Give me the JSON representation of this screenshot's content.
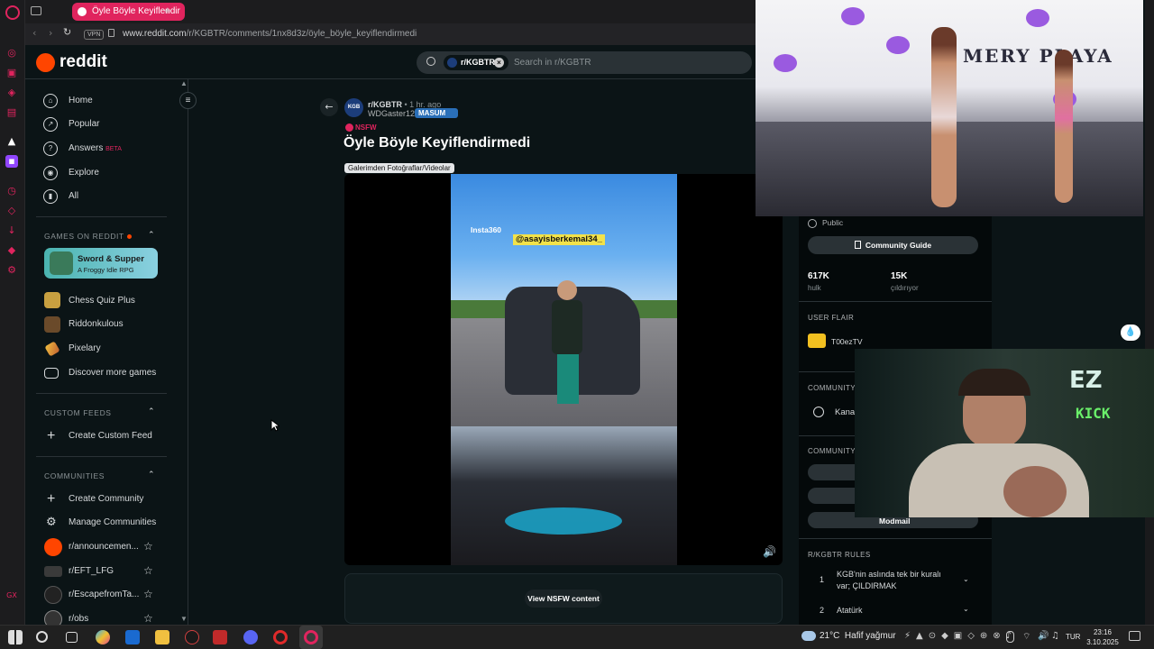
{
  "browser": {
    "tab_title": "Öyle Böyle Keyiflendir",
    "vpn_label": "VPN",
    "url_host": "www.reddit.com",
    "url_path": "/r/KGBTR/comments/1nx8d3z/öyle_böyle_keyiflendirmedi"
  },
  "reddit": {
    "logo_text": "reddit",
    "search_chip": "r/KGBTR",
    "search_placeholder": "Search in r/KGBTR"
  },
  "sidebar": {
    "nav": [
      {
        "label": "Home",
        "icon": "home-icon"
      },
      {
        "label": "Popular",
        "icon": "popular-icon"
      },
      {
        "label": "Answers",
        "badge": "BETA",
        "icon": "answers-icon"
      },
      {
        "label": "Explore",
        "icon": "explore-icon"
      },
      {
        "label": "All",
        "icon": "all-icon"
      }
    ],
    "games_title": "GAMES ON REDDIT",
    "featured_game": {
      "title": "Sword & Supper",
      "subtitle": "A Froggy Idle RPG"
    },
    "games": [
      "Chess Quiz Plus",
      "Riddonkulous",
      "Pixelary",
      "Discover more games"
    ],
    "custom_feeds_title": "CUSTOM FEEDS",
    "create_custom_feed": "Create Custom Feed",
    "communities_title": "COMMUNITIES",
    "create_community": "Create Community",
    "manage_communities": "Manage Communities",
    "communities": [
      "r/announcemen...",
      "r/EFT_LFG",
      "r/EscapefromTa...",
      "r/obs"
    ]
  },
  "post": {
    "subreddit": "r/KGBTR",
    "time": "• 1 hr. ago",
    "author": "WDGaster123",
    "author_flair": "MASUM",
    "nsfw_label": "NSFW",
    "title": "Öyle Böyle Keyiflendirmedi",
    "flair": "Galerimden Fotoğraflar/Videolar",
    "video_watermark": "Insta360",
    "video_tag": "@asayisberkemal34_",
    "view_nsfw_button": "View NSFW content"
  },
  "right_panel": {
    "visibility": "Public",
    "guide_button": "Community Guide",
    "stats": [
      {
        "value": "617K",
        "label": "hulk"
      },
      {
        "value": "15K",
        "label": "çıldırıyor"
      }
    ],
    "user_flair_title": "USER FLAIR",
    "user_flair_name": "T00ezTV",
    "community_section_1": "COMMUNITY",
    "community_link": "Kanal",
    "community_section_2": "COMMUNITY",
    "modmail_label": "Modmail",
    "rules_title": "R/KGBTR RULES",
    "rules": [
      {
        "num": "1",
        "text": "KGB'nin aslında tek bir kuralı var; ÇILDIRMAK"
      },
      {
        "num": "2",
        "text": "Atatürk"
      }
    ]
  },
  "overlays": {
    "runway_banner": "MERY PLAYA",
    "cam_sign_top": "EZ",
    "cam_sign_bottom": "KICK"
  },
  "taskbar": {
    "weather_temp": "21°C",
    "weather_text": "Hafif yağmur",
    "lang": "TUR",
    "time": "23:16",
    "date": "3.10.2025"
  },
  "colors": {
    "accent": "#e0245e",
    "reddit_orange": "#ff4500",
    "background": "#0b1416"
  }
}
